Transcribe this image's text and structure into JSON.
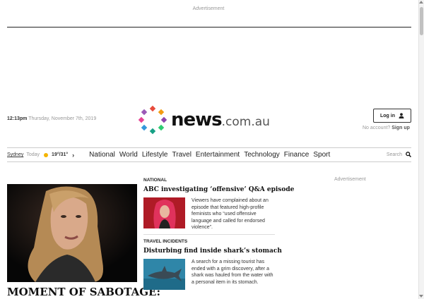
{
  "ads": {
    "top_label": "Advertisement",
    "side_label": "Advertisement"
  },
  "header": {
    "time": "12:13pm",
    "date": "Thursday, November 7th, 2019",
    "logo_main": "news",
    "logo_suffix": ".com.au",
    "login_label": "Log in",
    "no_account_text": "No account?",
    "signup_label": "Sign up"
  },
  "weather": {
    "city": "Sydney",
    "day": "Today",
    "temps": "19°/31°",
    "icon": "sun-icon"
  },
  "nav": {
    "items": [
      "National",
      "World",
      "Lifestyle",
      "Travel",
      "Entertainment",
      "Technology",
      "Finance",
      "Sport"
    ],
    "search_label": "Search"
  },
  "hero": {
    "title": "MOMENT OF SABOTAGE:"
  },
  "articles": [
    {
      "category": "NATIONAL",
      "headline": "ABC investigating ‘offensive’ Q&A episode",
      "summary": "Viewers have complained about an episode that featured high-profile feminists who “used offensive language and called for endorsed violence”."
    },
    {
      "category": "TRAVEL INCIDENTS",
      "headline": "Disturbing find inside shark’s stomach",
      "summary": "A search for a missing tourist has ended with a grim discovery, after a shark was hauled from the water with a personal item in its stomach."
    }
  ],
  "colors": {
    "accent": "#e0392b",
    "logo_dots": [
      "#e74c3c",
      "#f39c12",
      "#8e44ad",
      "#2ecc71",
      "#3498db",
      "#1abc9c",
      "#e84393",
      "#27ae60"
    ]
  }
}
